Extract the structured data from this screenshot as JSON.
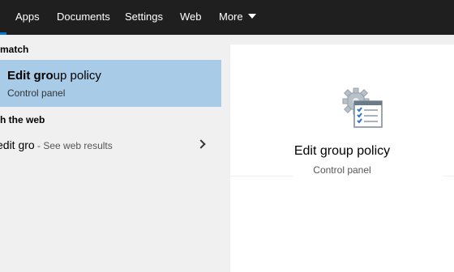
{
  "tabs": {
    "apps": "Apps",
    "documents": "Documents",
    "settings": "Settings",
    "web": "Web",
    "more": "More"
  },
  "best_match": {
    "header": "match",
    "title_bold": "Edit gro",
    "title_rest": "up policy",
    "subtitle": "Control panel"
  },
  "web_search": {
    "header": "h the web",
    "query": "edit gro",
    "suffix": " - See web results"
  },
  "preview": {
    "title": "Edit group policy",
    "subtitle": "Control panel",
    "icon": "group-policy-icon"
  },
  "colors": {
    "topbar": "#1f1f1f",
    "selected": "#a8cce8",
    "accent": "#0078d7"
  }
}
